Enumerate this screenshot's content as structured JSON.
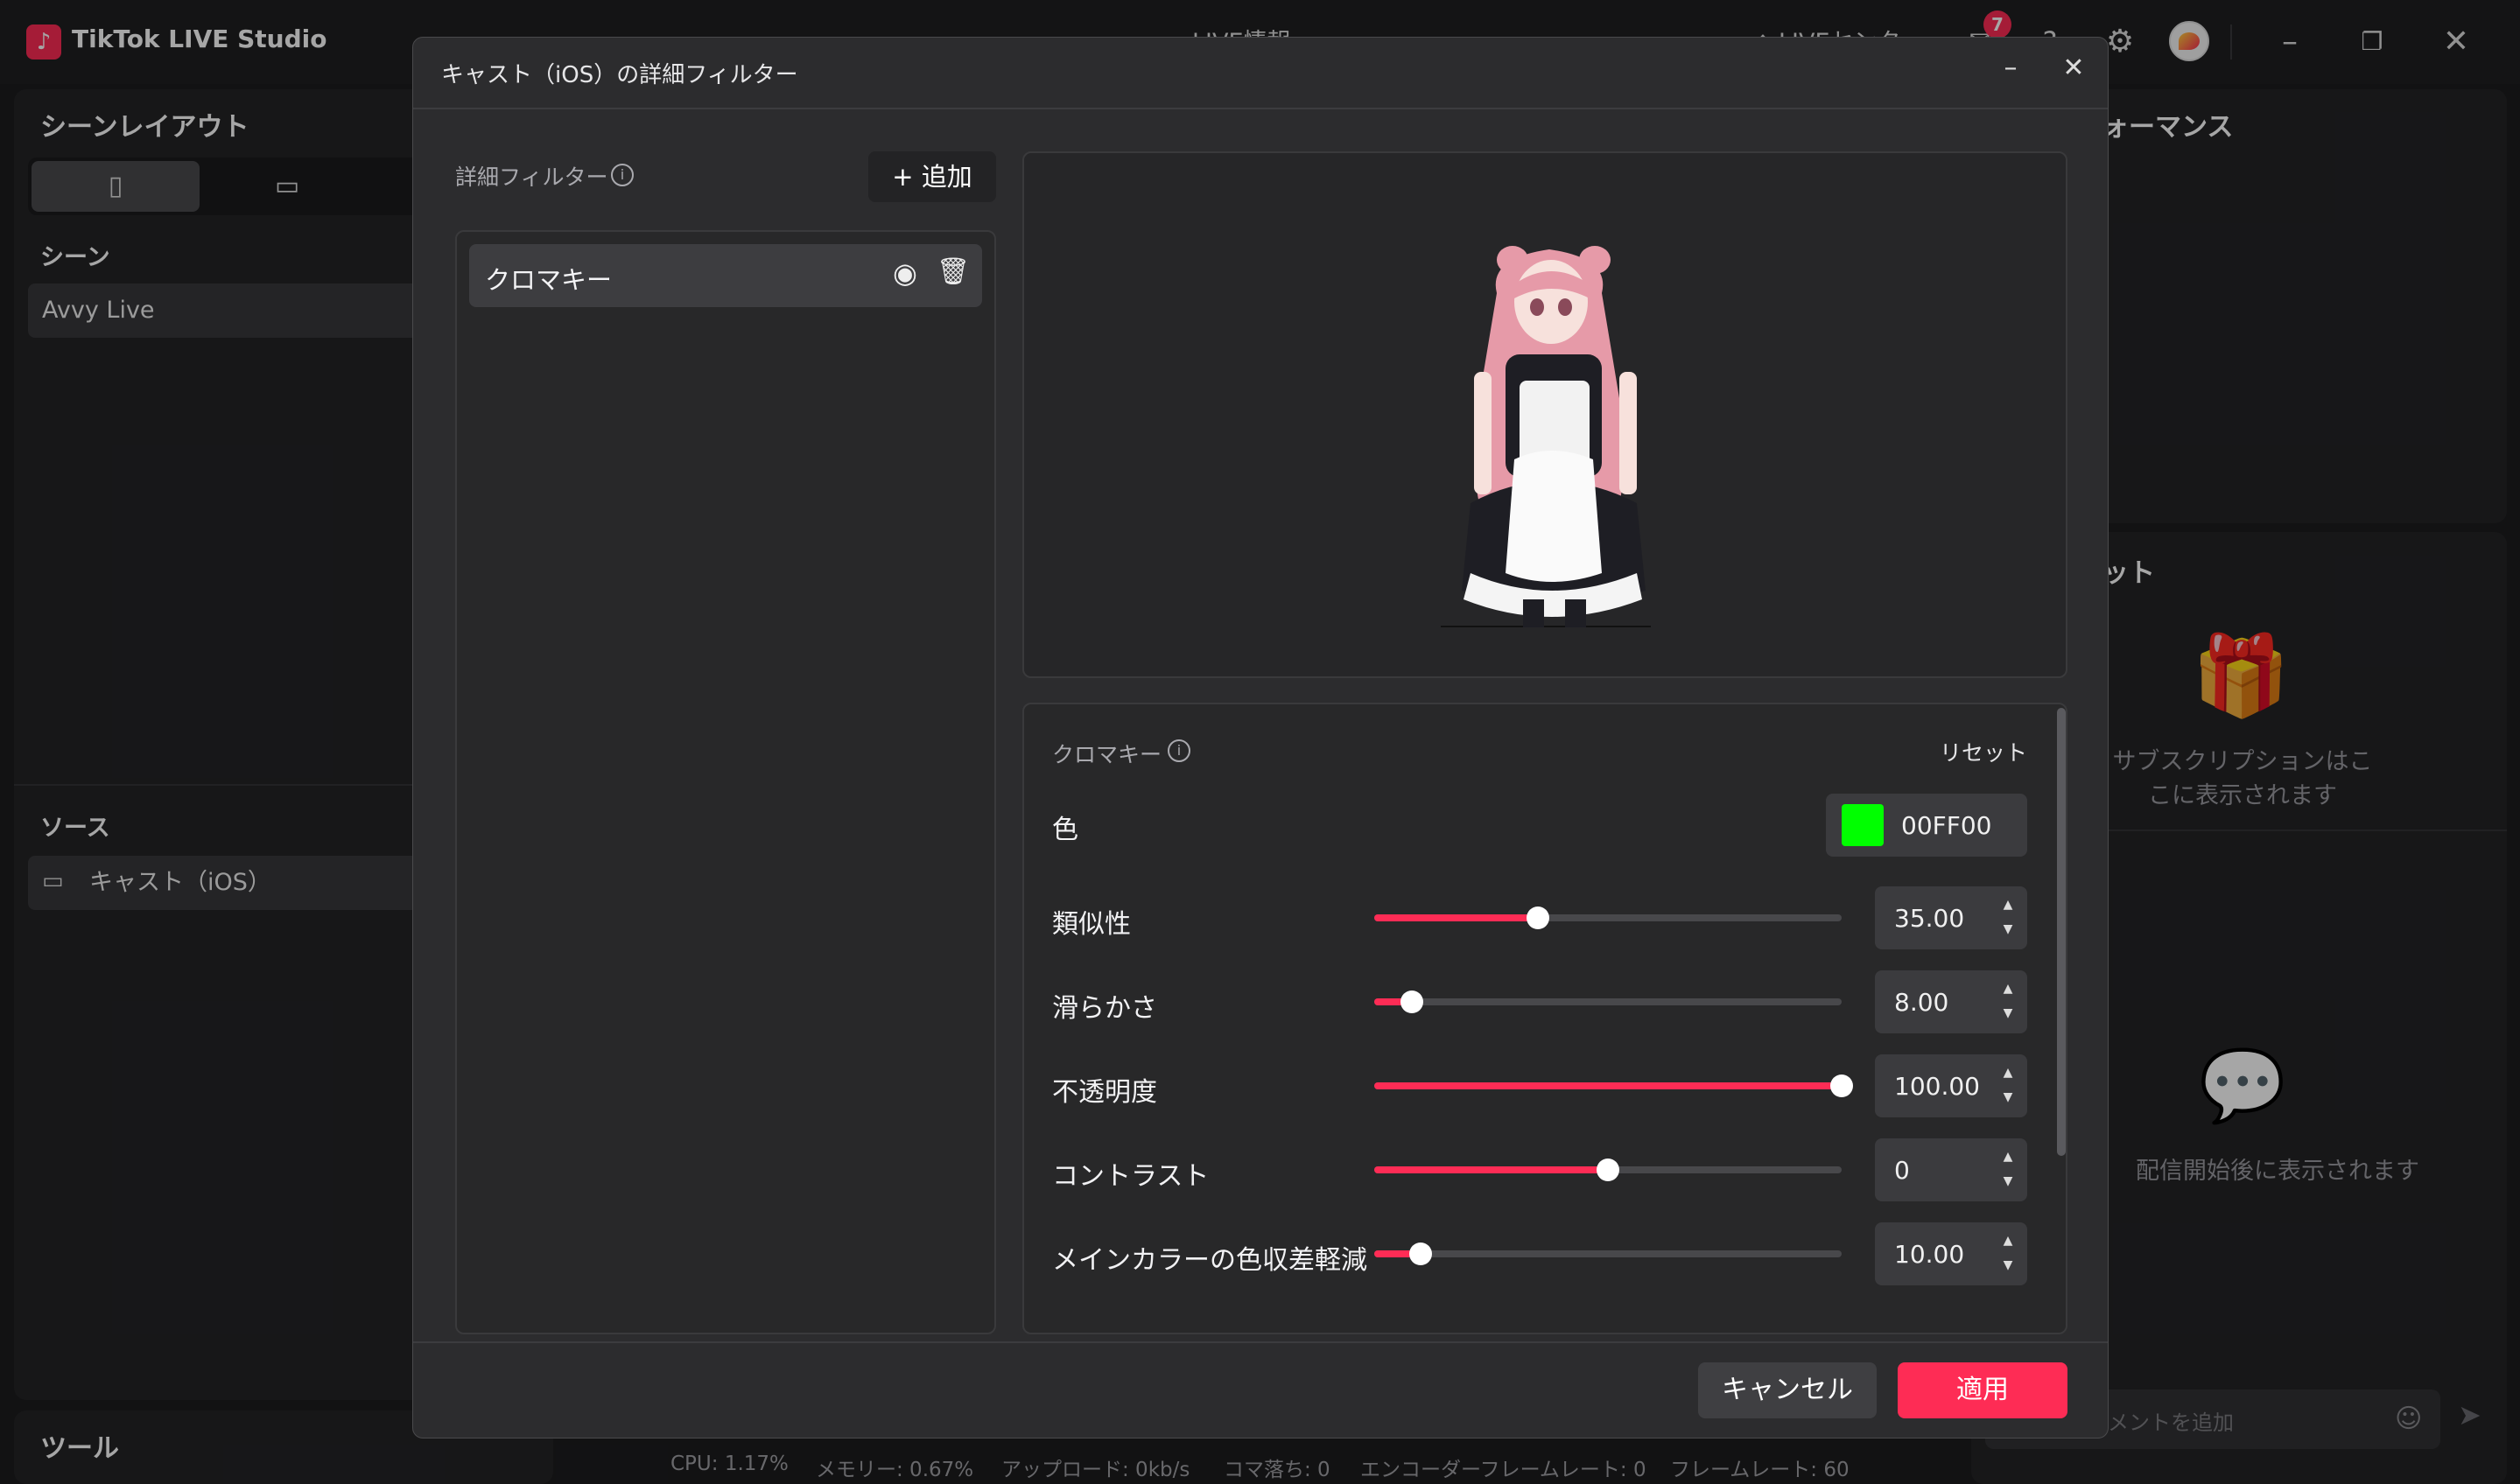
{
  "app": {
    "title": "TikTok LIVE Studio",
    "logo_icon": "tiktok-logo-icon"
  },
  "header": {
    "center_label": "LIVE情報",
    "live_center_label": "LIVEセンター",
    "notification_count": "7",
    "window_controls": [
      "minimize-icon",
      "maximize-icon",
      "close-icon"
    ]
  },
  "left": {
    "scene_layout_title": "シーンレイアウト",
    "scene_title": "シーン",
    "scene_item": "Avvy Live",
    "source_title": "ソース",
    "source_item": "キャスト（iOS）",
    "tools_title": "ツール"
  },
  "right": {
    "performance_title_partial": "ォーマンス",
    "subs_title_partial": "ット",
    "subs_text": "サブスクリプションはここに表示されます",
    "comments_text": "配信開始後に表示されます",
    "comment_placeholder": "メントを追加"
  },
  "status": {
    "cpu": "CPU:  1.17%",
    "memory": "メモリー:  0.67%",
    "upload": "アップロード:  0kb/s",
    "drop": "コマ落ち:  0",
    "encoder_fps": "エンコーダーフレームレート:  0",
    "fps": "フレームレート:  60"
  },
  "modal": {
    "title": "キャスト（iOS）の詳細フィルター",
    "filters_label": "詳細フィルター",
    "add_label": "追加",
    "filter_item": "クロマキー",
    "settings_title": "クロマキー",
    "reset_label": "リセット",
    "color_label": "色",
    "color_value": "00FF00",
    "color_hex": "#00ff00",
    "sliders": [
      {
        "label": "類似性",
        "value": "35.00",
        "fraction": 0.35
      },
      {
        "label": "滑らかさ",
        "value": "8.00",
        "fraction": 0.08
      },
      {
        "label": "不透明度",
        "value": "100.00",
        "fraction": 1.0
      },
      {
        "label": "コントラスト",
        "value": "0",
        "fraction": 0.5
      },
      {
        "label": "メインカラーの色収差軽減",
        "value": "10.00",
        "fraction": 0.1
      }
    ],
    "cancel_label": "キャンセル",
    "apply_label": "適用"
  },
  "colors": {
    "accent": "#fe2c55",
    "background": "#1c1c1e",
    "modal": "#2c2c2e"
  }
}
